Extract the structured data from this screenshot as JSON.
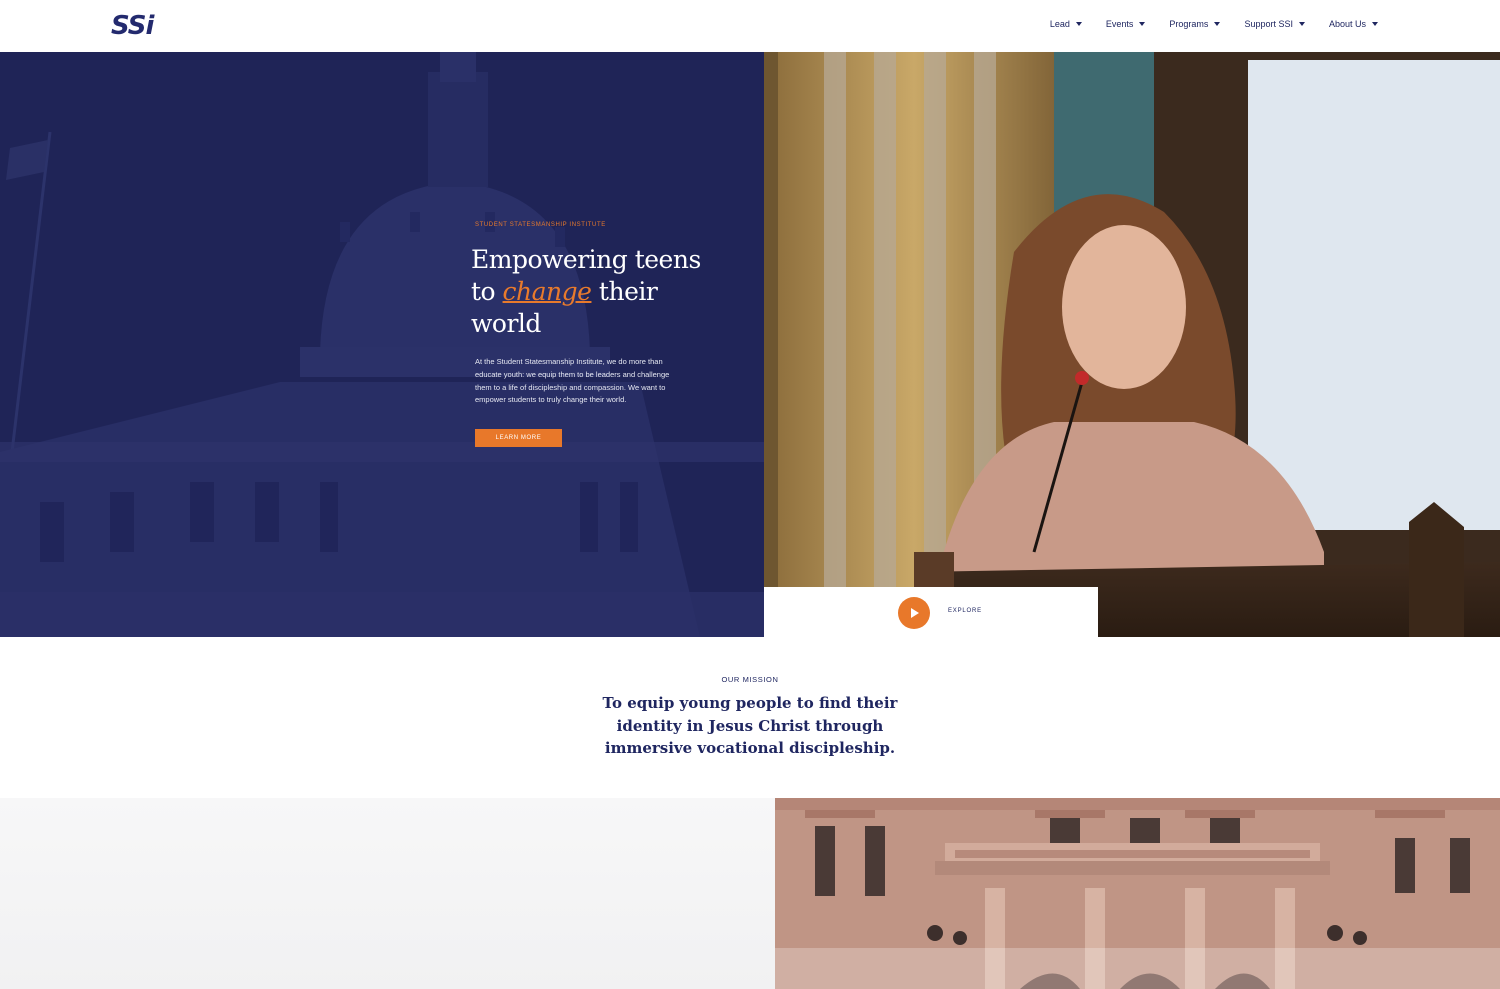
{
  "header": {
    "logo_text": "SSi",
    "nav": [
      {
        "label": "Lead"
      },
      {
        "label": "Events"
      },
      {
        "label": "Programs"
      },
      {
        "label": "Support SSI"
      },
      {
        "label": "About Us"
      }
    ]
  },
  "hero": {
    "eyebrow": "STUDENT STATESMANSHIP INSTITUTE",
    "headline_part1": "Empowering teens to ",
    "headline_accent": "change",
    "headline_part2": " their world",
    "body": "At the Student Statesmanship Institute, we do more than educate youth: we equip them to be leaders and challenge them to a life of discipleship and compassion. We want to empower students to truly change their world.",
    "cta_label": "LEARN MORE",
    "explore_label": "EXPLORE"
  },
  "mission": {
    "eyebrow": "OUR MISSION",
    "text": "To equip young people to find their identity in Jesus Christ through immersive vocational discipleship."
  },
  "colors": {
    "navy": "#1f2457",
    "accent": "#e8782a",
    "text_dark": "#1f2660"
  },
  "icons": {
    "play": "play-icon",
    "caret": "caret-down-icon"
  }
}
